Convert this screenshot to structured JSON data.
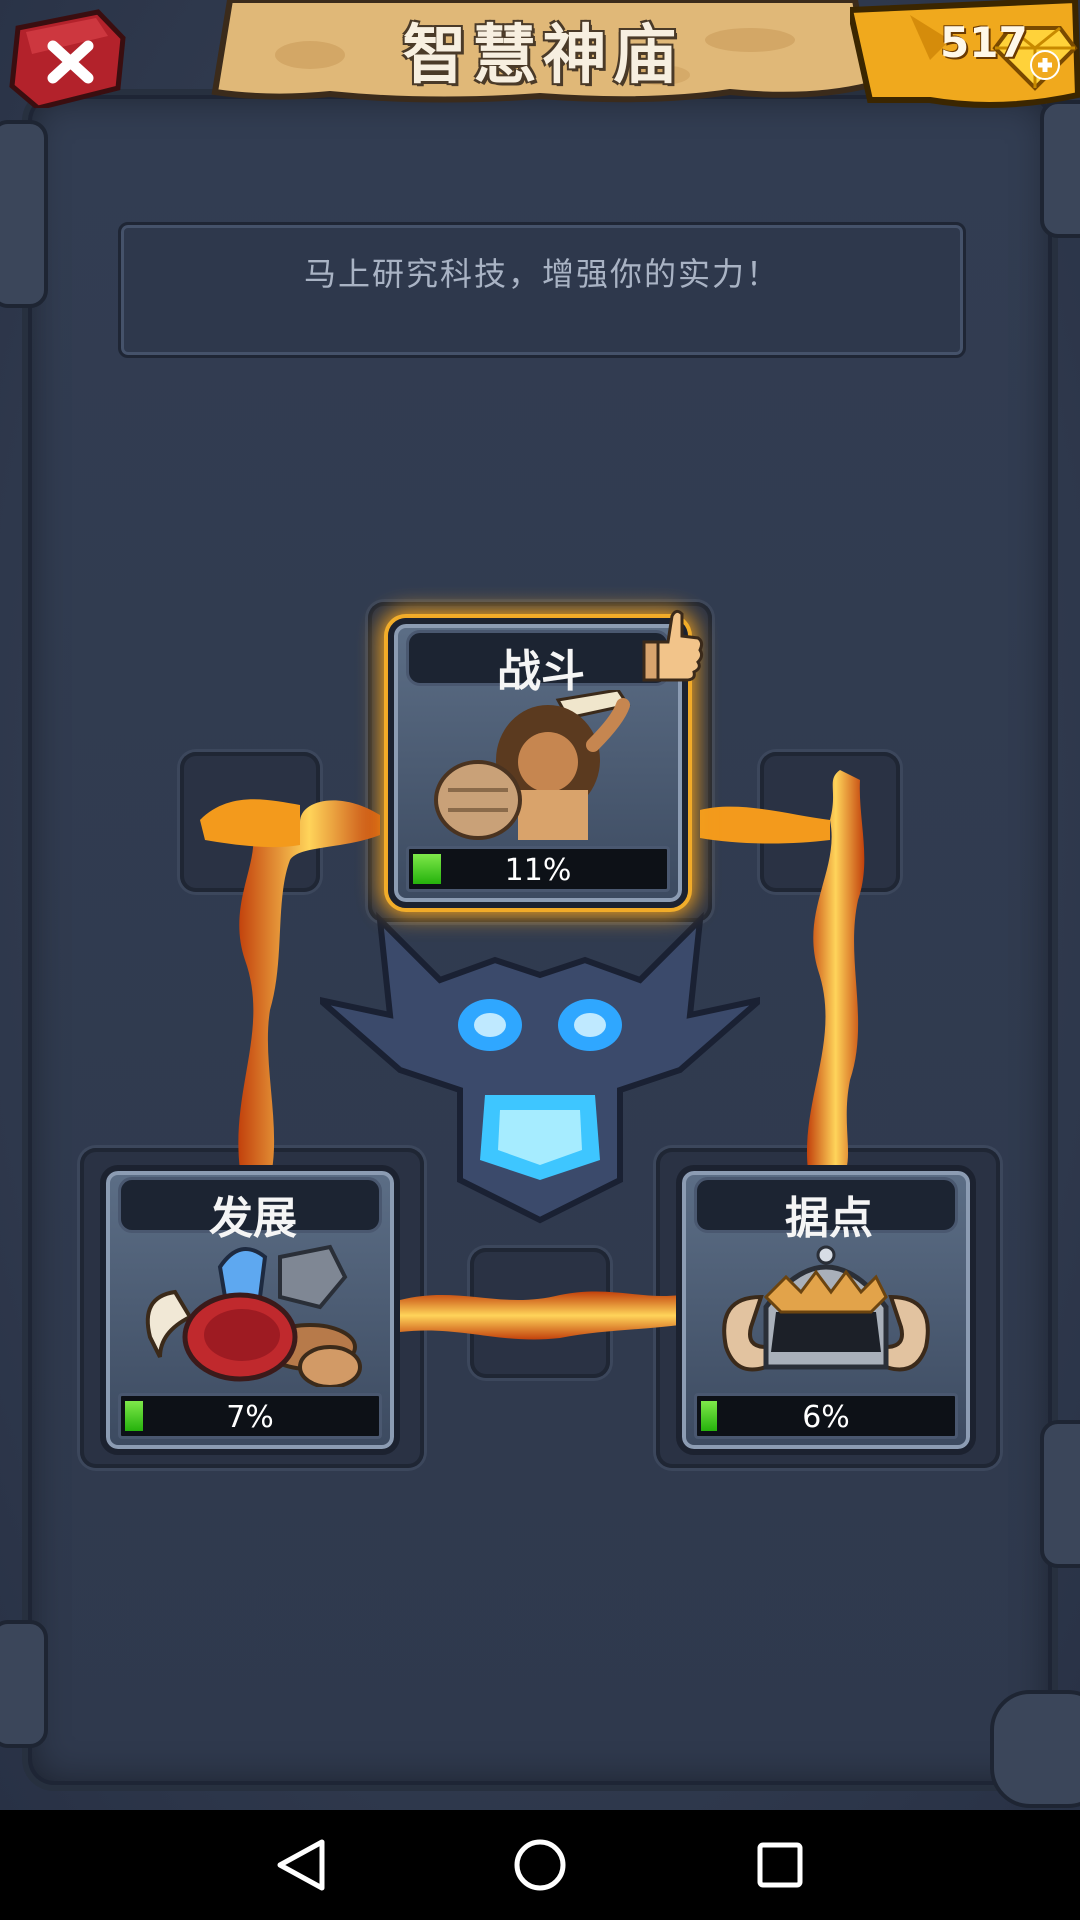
{
  "header": {
    "title": "智慧神庙",
    "gems": "517"
  },
  "message": "马上研究科技，增强你的实力！",
  "cards": {
    "combat": {
      "title": "战斗",
      "progress_label": "11%",
      "progress": 0.11,
      "recommended_icon": "thumbs-up-icon"
    },
    "development": {
      "title": "发展",
      "progress_label": "7%",
      "progress": 0.07
    },
    "stronghold": {
      "title": "据点",
      "progress_label": "6%",
      "progress": 0.06
    }
  },
  "icons": {
    "close": "close-icon",
    "gem": "gem-icon",
    "add": "plus-icon",
    "skull": "skull-emblem-icon",
    "nav_back": "back-triangle-icon",
    "nav_home": "home-circle-icon",
    "nav_recent": "recent-square-icon"
  },
  "colors": {
    "lava": "#f39a1c",
    "progress_green": "#34c417",
    "gem_gold": "#f2b928",
    "close_red": "#c0262b"
  }
}
